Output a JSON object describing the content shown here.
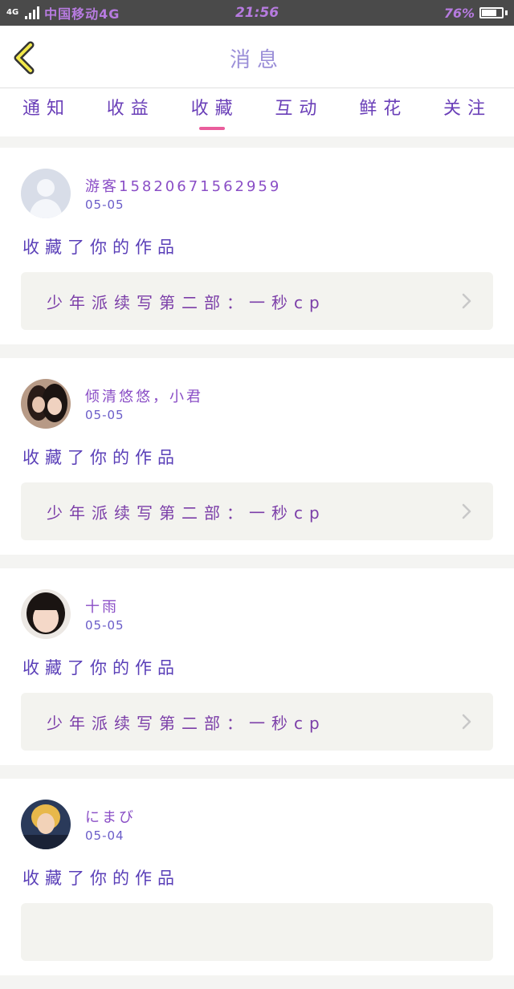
{
  "status_bar": {
    "network": "4G",
    "carrier": "中国移动4G",
    "time": "21:56",
    "battery": "76%",
    "battery_level": 0.76
  },
  "header": {
    "title": "消息",
    "back_icon": "chevron-left-icon"
  },
  "tabs": [
    {
      "label": "通知",
      "active": false
    },
    {
      "label": "收益",
      "active": false
    },
    {
      "label": "收藏",
      "active": true
    },
    {
      "label": "互动",
      "active": false
    },
    {
      "label": "鲜花",
      "active": false
    },
    {
      "label": "关注",
      "active": false
    }
  ],
  "messages": [
    {
      "user": "游客15820671562959",
      "date": "05-05",
      "action": "收藏了你的作品",
      "work_title": "少年派续写第二部：一秒cp",
      "avatar": "default-avatar-icon"
    },
    {
      "user": "倾清悠悠，小君",
      "date": "05-05",
      "action": "收藏了你的作品",
      "work_title": "少年派续写第二部：一秒cp",
      "avatar": "user-photo"
    },
    {
      "user": "十雨",
      "date": "05-05",
      "action": "收藏了你的作品",
      "work_title": "少年派续写第二部：一秒cp",
      "avatar": "user-photo"
    },
    {
      "user": "にまび",
      "date": "05-04",
      "action": "收藏了你的作品",
      "work_title": "",
      "avatar": "user-photo"
    }
  ],
  "colors": {
    "accent_underline": "#ea5d9c",
    "tab_text": "#6a3fb8",
    "title_text": "#9b8fd8",
    "statusbar_bg": "#4a4a4a"
  }
}
